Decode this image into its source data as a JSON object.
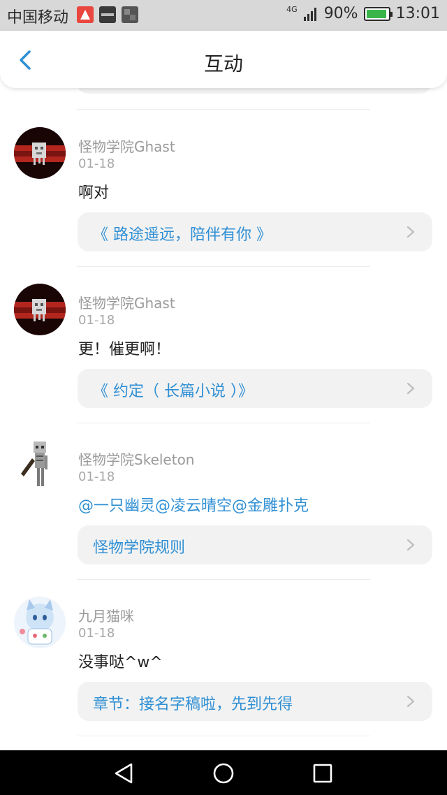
{
  "status_bar": {
    "carrier": "中国移动",
    "network": "4G",
    "battery": "90%",
    "time": "13:01",
    "notification_icons": [
      "app-icon-1",
      "revenge-app-icon",
      "minecraft-app-icon"
    ]
  },
  "header": {
    "title": "互动",
    "back_icon": "chevron-left-icon"
  },
  "items": [
    {
      "name": "怪物学院Ghast",
      "date": "01-18",
      "content": "啊对",
      "content_is_link": false,
      "card": "《 路途遥远，陪伴有你 》",
      "avatar": "ghast-avatar"
    },
    {
      "name": "怪物学院Ghast",
      "date": "01-18",
      "content": "更！催更啊！",
      "content_is_link": false,
      "card": "《 约定（ 长篇小说 ）》",
      "avatar": "ghast-avatar"
    },
    {
      "name": "怪物学院Skeleton",
      "date": "01-18",
      "content": "@一只幽灵@凌云晴空@金雕扑克",
      "content_is_link": true,
      "card": "怪物学院规则",
      "avatar": "skeleton-avatar"
    },
    {
      "name": "九月猫咪",
      "date": "01-18",
      "content": "没事哒^w^",
      "content_is_link": false,
      "card": "章节：接名字稿啦，先到先得",
      "avatar": "cat-girl-avatar"
    }
  ],
  "colors": {
    "accent": "#2f8fd4",
    "card_bg": "#f2f2f2",
    "meta_text": "#9a9a9a"
  },
  "nav": [
    "back-triangle-icon",
    "home-circle-icon",
    "recents-square-icon"
  ]
}
